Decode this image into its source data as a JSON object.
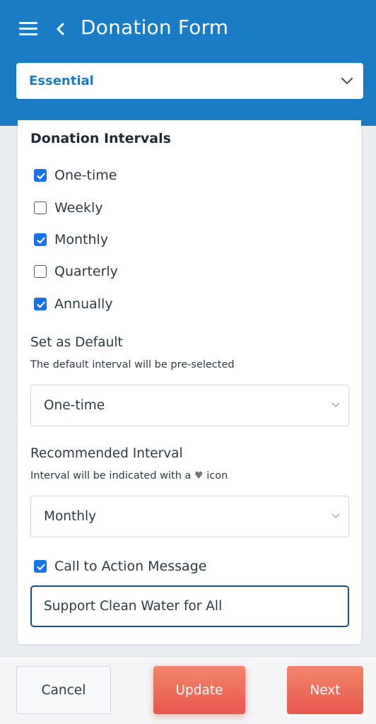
{
  "header": {
    "title": "Donation Form",
    "menu_icon": "hamburger-menu-icon",
    "back_icon": "chevron-left-icon",
    "background": "#1a7cc4"
  },
  "plan_select": {
    "value": "Essential",
    "color": "#1a7cc4"
  },
  "intervals": {
    "title": "Donation Intervals",
    "options": [
      {
        "label": "One-time",
        "checked": true
      },
      {
        "label": "Weekly",
        "checked": false
      },
      {
        "label": "Monthly",
        "checked": true
      },
      {
        "label": "Quarterly",
        "checked": false
      },
      {
        "label": "Annually",
        "checked": true
      }
    ]
  },
  "default_interval": {
    "label": "Set as Default",
    "help": "The default interval will be pre-selected",
    "value": "One-time"
  },
  "recommended_interval": {
    "label": "Recommended Interval",
    "help_before": "Interval will be indicated with a",
    "help_icon": "heart-icon",
    "help_after": "icon",
    "value": "Monthly"
  },
  "cta": {
    "checkbox_label": "Call to Action Message",
    "checked": true,
    "value": "Support Clean Water for All"
  },
  "footer": {
    "cancel_label": "Cancel",
    "update_label": "Update",
    "next_label": "Next",
    "accent": "#e8584e"
  }
}
